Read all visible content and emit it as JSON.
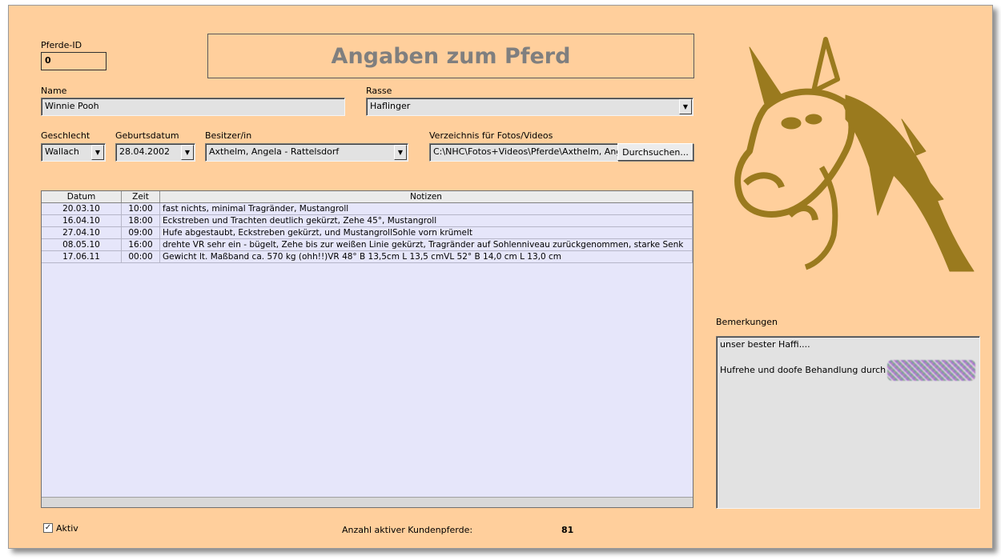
{
  "form": {
    "title": "Angaben zum Pferd",
    "id": {
      "label": "Pferde-ID",
      "value": "0"
    },
    "name": {
      "label": "Name",
      "value": "Winnie Pooh"
    },
    "breed": {
      "label": "Rasse",
      "value": "Haflinger"
    },
    "sex": {
      "label": "Geschlecht",
      "value": "Wallach"
    },
    "birth": {
      "label": "Geburtsdatum",
      "value": "28.04.2002"
    },
    "owner": {
      "label": "Besitzer/in",
      "value": "Axthelm, Angela - Rattelsdorf"
    },
    "folder": {
      "label": "Verzeichnis für Fotos/Videos",
      "value": "C:\\NHC\\Fotos+Videos\\Pferde\\Axthelm, Ang",
      "browse_label": "Durchsuchen..."
    }
  },
  "table": {
    "headers": [
      "Datum",
      "Zeit",
      "Notizen"
    ],
    "rows": [
      {
        "date": "20.03.10",
        "time": "10:00",
        "note": "fast nichts, minimal Tragränder, Mustangroll"
      },
      {
        "date": "16.04.10",
        "time": "18:00",
        "note": "Eckstreben und Trachten deutlich gekürzt, Zehe 45°, Mustangroll"
      },
      {
        "date": "27.04.10",
        "time": "09:00",
        "note": "Hufe abgestaubt, Eckstreben gekürzt, und MustangrollSohle vorn krümelt"
      },
      {
        "date": "08.05.10",
        "time": "16:00",
        "note": "drehte VR sehr ein - bügelt, Zehe bis zur weißen Linie gekürzt, Tragränder auf Sohlenniveau zurückgenommen, starke Senk"
      },
      {
        "date": "17.06.11",
        "time": "00:00",
        "note": "Gewicht lt. Maßband ca. 570 kg (ohh!!)VR 48°   B 13,5cm L  13,5 cmVL 52°   B 14,0 cm L  13,0 cm"
      }
    ]
  },
  "remarks": {
    "label": "Bemerkungen",
    "line1": "unser bester Haffi....",
    "line2": "Hufrehe und doofe Behandlung durch"
  },
  "footer": {
    "active_label": "Aktiv",
    "count_label": "Anzahl aktiver Kundenpferde:",
    "count_value": "81"
  },
  "icons": {
    "logo": "horse-head-logo",
    "dropdown": "chevron-down-icon",
    "check": "checkmark-icon"
  },
  "colors": {
    "background": "#ffcf9c",
    "grid": "#e6e6fa",
    "logo": "#9a7a1e",
    "title": "#7f7f7f"
  }
}
